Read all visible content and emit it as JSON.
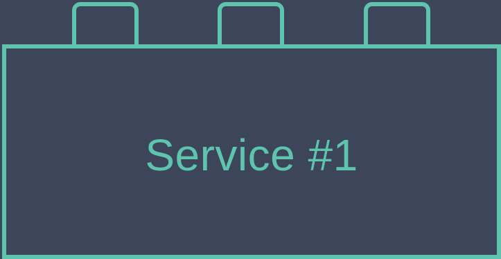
{
  "block": {
    "label": "Service #1"
  },
  "colors": {
    "background": "#3d455b",
    "accent": "#5ec4ad"
  },
  "stud_count": 3
}
